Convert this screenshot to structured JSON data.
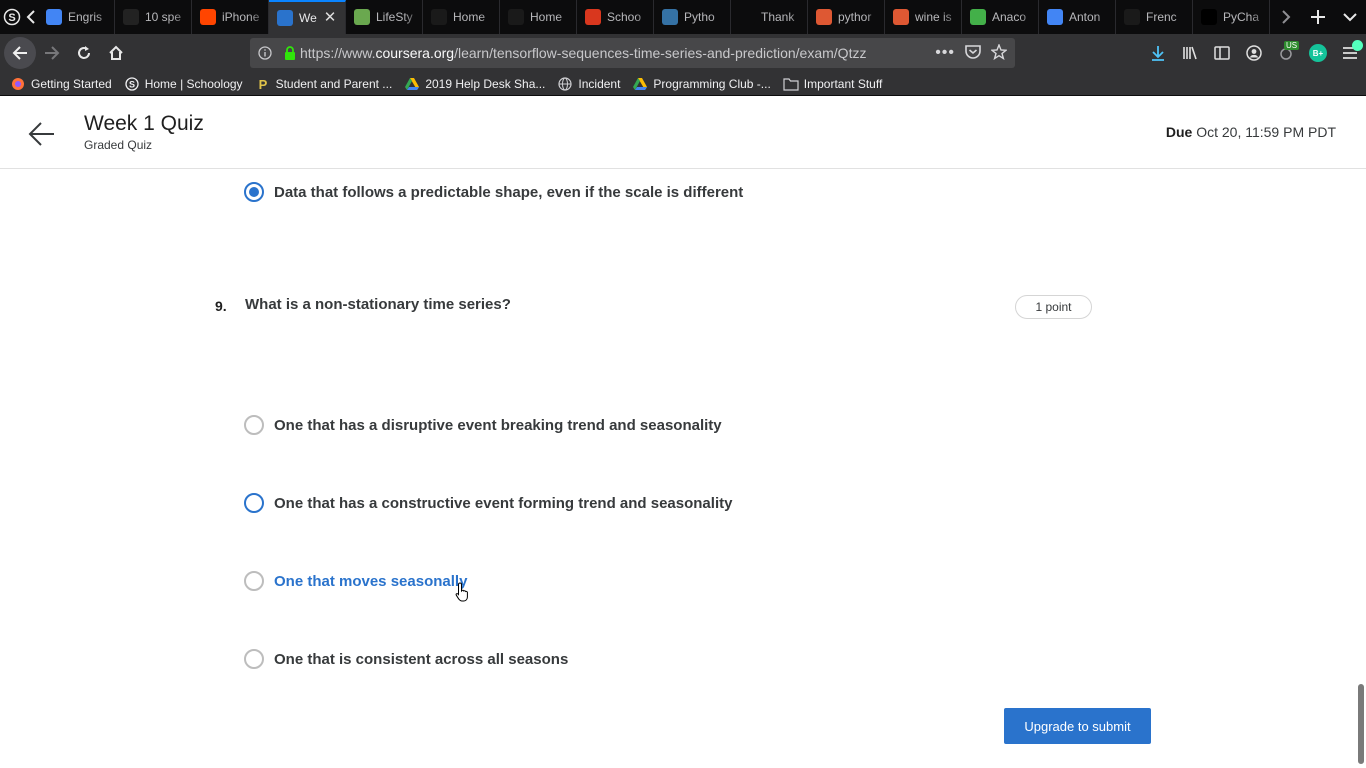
{
  "browser": {
    "tabs": [
      {
        "label": "Engris",
        "icon": "docs-icon",
        "color": "#4285f4"
      },
      {
        "label": "10 spe",
        "icon": "cnn-icon",
        "color": "#222222"
      },
      {
        "label": "iPhone",
        "icon": "reddit-icon",
        "color": "#ff4500"
      },
      {
        "label": "We",
        "icon": "coursera-icon",
        "color": "#2a73cc",
        "active": true
      },
      {
        "label": "LifeSty",
        "icon": "image-icon",
        "color": "#6aa84f"
      },
      {
        "label": "Home",
        "icon": "schoology-icon",
        "color": "#1a1a1a"
      },
      {
        "label": "Home",
        "icon": "schoology-icon",
        "color": "#1a1a1a"
      },
      {
        "label": "Schoo",
        "icon": "loading-icon",
        "color": "#d9371e"
      },
      {
        "label": "Pytho",
        "icon": "python-icon",
        "color": "#3572a5"
      },
      {
        "label": "Thank",
        "icon": "blank-icon",
        "color": "#0c0c0d"
      },
      {
        "label": "pythor",
        "icon": "duckduckgo-icon",
        "color": "#de5833"
      },
      {
        "label": "wine is",
        "icon": "duckduckgo-icon",
        "color": "#de5833"
      },
      {
        "label": "Anaco",
        "icon": "loading-icon",
        "color": "#43b049"
      },
      {
        "label": "Anton",
        "icon": "docs-icon",
        "color": "#4285f4"
      },
      {
        "label": "Frenc",
        "icon": "schoology-icon",
        "color": "#1a1a1a"
      },
      {
        "label": "PyCha",
        "icon": "jetbrains-icon",
        "color": "#000000"
      }
    ],
    "url_prefix": "https://www.",
    "url_host": "coursera.org",
    "url_path": "/learn/tensorflow-sequences-time-series-and-prediction/exam/Qtzz",
    "bookmarks": [
      {
        "label": "Getting Started",
        "icon": "firefox-icon"
      },
      {
        "label": "Home | Schoology",
        "icon": "schoology-icon"
      },
      {
        "label": "Student and Parent ...",
        "icon": "powerschool-icon"
      },
      {
        "label": "2019 Help Desk Sha...",
        "icon": "drive-icon"
      },
      {
        "label": "Incident",
        "icon": "globe-icon"
      },
      {
        "label": "Programming Club -...",
        "icon": "drive-icon"
      },
      {
        "label": "Important Stuff",
        "icon": "folder-icon"
      }
    ],
    "badges": {
      "vpn": "US",
      "ext": "B+"
    }
  },
  "header": {
    "title": "Week 1 Quiz",
    "subtitle": "Graded Quiz",
    "due_label": "Due",
    "due_value": "Oct 20, 11:59 PM PDT"
  },
  "prev_question": {
    "selected_option": "Data that follows a predictable shape, even if the scale is different"
  },
  "question": {
    "number": "9.",
    "text": "What is a non-stationary time series?",
    "points": "1 point",
    "options": [
      "One that has a disruptive event breaking trend and seasonality",
      "One that has a constructive event forming trend and seasonality",
      "One that moves seasonally",
      "One that is consistent across all seasons"
    ]
  },
  "submit": {
    "label": "Upgrade to submit"
  },
  "colors": {
    "accent": "#2a73cc",
    "text": "#373a3c",
    "chrome_dark": "#0c0c0d",
    "chrome": "#323234"
  }
}
